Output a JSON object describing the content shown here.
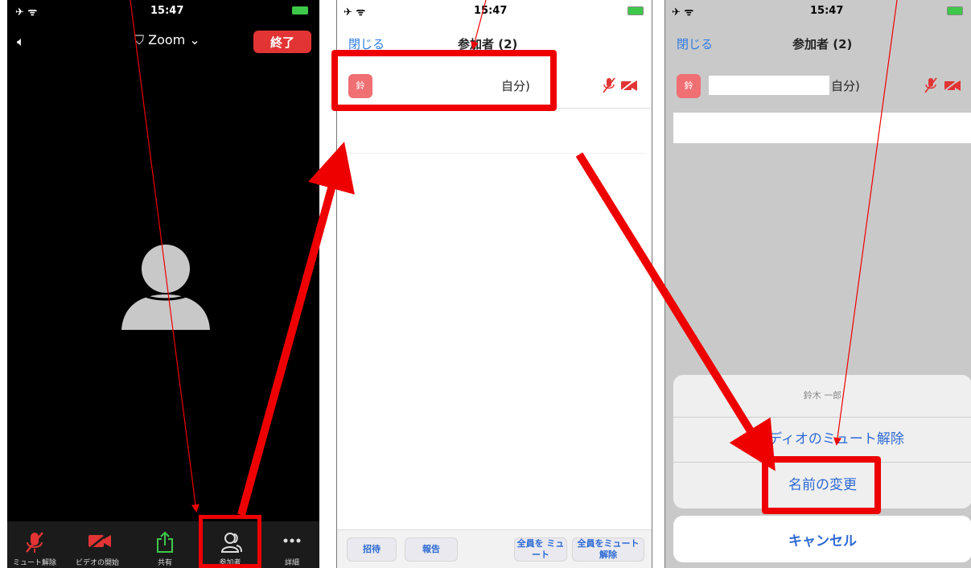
{
  "status_bar": {
    "left": "✈ ᯤ",
    "time": "15:47"
  },
  "meeting": {
    "title": "Zoom",
    "end_label": "終了",
    "toolbar": [
      {
        "label": "ミュート解除",
        "icon": "mic-muted-icon"
      },
      {
        "label": "ビデオの開始",
        "icon": "video-off-icon"
      },
      {
        "label": "共有",
        "icon": "share-icon"
      },
      {
        "label": "参加者",
        "icon": "participants-icon"
      },
      {
        "label": "詳細",
        "icon": "more-icon"
      }
    ]
  },
  "participants": {
    "close_label": "閉じる",
    "title": "参加者 (2)",
    "row": {
      "avatar_text": "鈴",
      "self_suffix": "自分)"
    },
    "bottom": {
      "invite": "招待",
      "report": "報告",
      "mute_all": "全員を ミュート",
      "unmute_all": "全員をミュート 解除"
    }
  },
  "action_sheet": {
    "header": "鈴木 一郎",
    "unmute_audio": "オーディオのミュート解除",
    "rename": "名前の変更",
    "cancel": "キャンセル"
  },
  "colors": {
    "accent_red": "#e00000",
    "ios_blue": "#2d6ad4",
    "end_red": "#e23434",
    "battery_green": "#3ec84a"
  }
}
